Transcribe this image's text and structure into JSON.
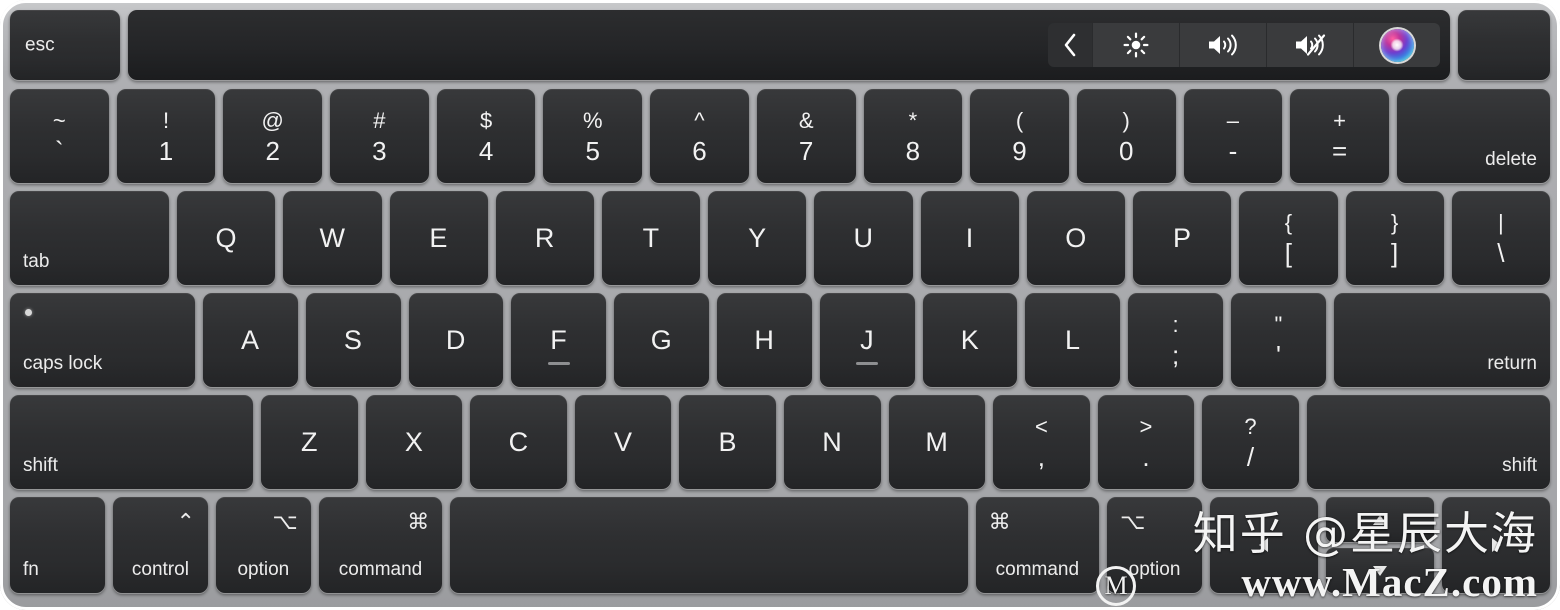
{
  "device": {
    "name": "MacBook Pro keyboard with Touch Bar",
    "frame_color": "#aaabae",
    "key_color": "#2e2f31",
    "highlight_color": "#d81418"
  },
  "touch_bar": {
    "esc_label": "esc",
    "controls": [
      {
        "name": "chevron-left-icon",
        "label": "‹"
      },
      {
        "name": "brightness-icon",
        "label": "brightness"
      },
      {
        "name": "volume-up-icon",
        "label": "volume up"
      },
      {
        "name": "mute-icon",
        "label": "mute"
      },
      {
        "name": "siri-icon",
        "label": "Siri"
      }
    ]
  },
  "rows": {
    "number_row": [
      {
        "top": "~",
        "bottom": "`"
      },
      {
        "top": "!",
        "bottom": "1"
      },
      {
        "top": "@",
        "bottom": "2"
      },
      {
        "top": "#",
        "bottom": "3"
      },
      {
        "top": "$",
        "bottom": "4"
      },
      {
        "top": "%",
        "bottom": "5"
      },
      {
        "top": "^",
        "bottom": "6"
      },
      {
        "top": "&",
        "bottom": "7"
      },
      {
        "top": "*",
        "bottom": "8"
      },
      {
        "top": "(",
        "bottom": "9"
      },
      {
        "top": ")",
        "bottom": "0"
      },
      {
        "top": "–",
        "bottom": "-"
      },
      {
        "top": "+",
        "bottom": "="
      }
    ],
    "delete_label": "delete",
    "tab_label": "tab",
    "qwerty_row": [
      "Q",
      "W",
      "E",
      "R",
      "T",
      "Y",
      "U",
      "I",
      "O",
      "P"
    ],
    "qwerty_symbols": [
      {
        "top": "{",
        "bottom": "["
      },
      {
        "top": "}",
        "bottom": "]"
      },
      {
        "top": "|",
        "bottom": "\\"
      }
    ],
    "caps_lock_label": "caps lock",
    "home_row": [
      "A",
      "S",
      "D",
      "F",
      "G",
      "H",
      "J",
      "K",
      "L"
    ],
    "home_symbols": [
      {
        "top": ":",
        "bottom": ";"
      },
      {
        "top": "\"",
        "bottom": "'"
      }
    ],
    "return_label": "return",
    "shift_left_label": "shift",
    "bottom_letters": [
      "Z",
      "X",
      "C",
      "V",
      "B",
      "N",
      "M"
    ],
    "bottom_symbols": [
      {
        "top": "<",
        "bottom": ",",
        "highlighted": true
      },
      {
        "top": ">",
        "bottom": ".",
        "highlighted": false
      },
      {
        "top": "?",
        "bottom": "/",
        "highlighted": false
      }
    ],
    "shift_right_label": "shift",
    "modifier_row": [
      {
        "name": "fn",
        "label": "fn",
        "glyph": ""
      },
      {
        "name": "control",
        "label": "control",
        "glyph": "⌃"
      },
      {
        "name": "option-left",
        "label": "option",
        "glyph": "⌥"
      },
      {
        "name": "command-left",
        "label": "command",
        "glyph": "⌘",
        "highlighted": true
      },
      {
        "name": "space",
        "label": "",
        "glyph": ""
      },
      {
        "name": "command-right",
        "label": "command",
        "glyph": "⌘"
      },
      {
        "name": "option-right",
        "label": "option",
        "glyph": "⌥"
      }
    ],
    "arrow_keys": [
      {
        "name": "arrow-left",
        "label": "◀"
      },
      {
        "name": "arrow-up",
        "label": "▲"
      },
      {
        "name": "arrow-down",
        "label": "▼"
      },
      {
        "name": "arrow-right",
        "label": "▶"
      }
    ]
  },
  "watermarks": {
    "zhihu": "知乎 @星辰大海",
    "macz": "www.MacZ.com",
    "logo": "M"
  }
}
